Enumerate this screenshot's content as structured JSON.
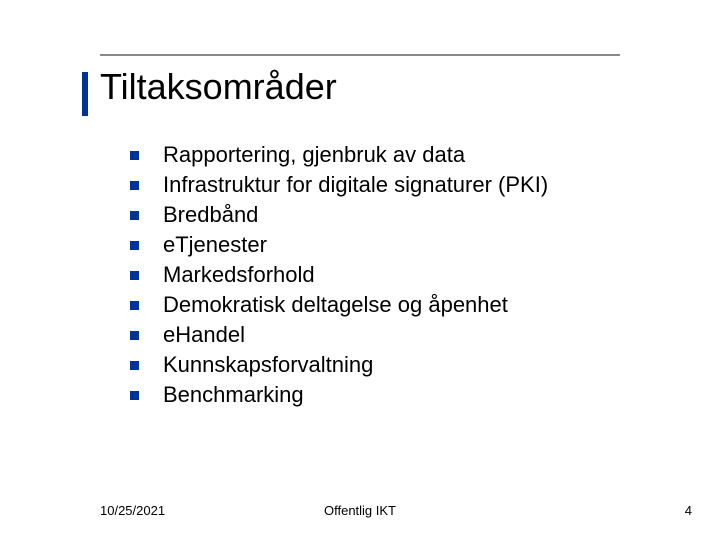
{
  "title": "Tiltaksområder",
  "bullets": [
    "Rapportering, gjenbruk av data",
    "Infrastruktur for digitale signaturer (PKI)",
    "Bredbånd",
    "eTjenester",
    "Markedsforhold",
    "Demokratisk deltagelse og åpenhet",
    "eHandel",
    "Kunnskapsforvaltning",
    "Benchmarking"
  ],
  "footer": {
    "date": "10/25/2021",
    "center": "Offentlig IKT",
    "page": "4"
  },
  "colors": {
    "accent": "#003399"
  }
}
